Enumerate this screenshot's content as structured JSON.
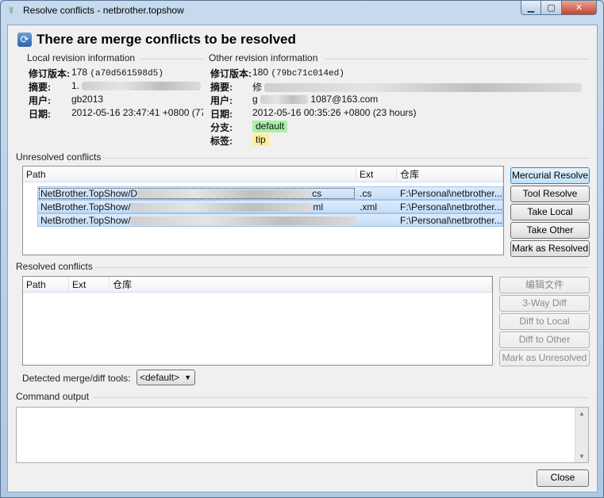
{
  "window": {
    "title": "Resolve conflicts - netbrother.topshow",
    "header": "There are merge conflicts to be resolved"
  },
  "local": {
    "section_label": "Local revision information",
    "revision_key": "修订版本:",
    "revision_value": "178",
    "revision_hash": "(a70d561598d5)",
    "summary_key": "摘要:",
    "summary_prefix": "1.",
    "user_key": "用户:",
    "user_value": "gb2013",
    "date_key": "日期:",
    "date_value": "2012-05-16 23:47:41 +0800 (77"
  },
  "other": {
    "section_label": "Other revision information",
    "revision_key": "修订版本:",
    "revision_value": "180",
    "revision_hash": "(79bc71c014ed)",
    "summary_key": "摘要:",
    "summary_prefix": "修",
    "user_key": "用户:",
    "user_prefix": "g",
    "user_suffix": "1087@163.com",
    "date_key": "日期:",
    "date_value": "2012-05-16 00:35:26 +0800 (23 hours)",
    "branch_key": "分支:",
    "branch_value": "default",
    "tags_key": "标签:",
    "tags_value": "tip"
  },
  "unresolved": {
    "label": "Unresolved conflicts",
    "columns": [
      "Path",
      "Ext",
      "仓库"
    ],
    "rows": [
      {
        "path_prefix": "NetBrother.TopShow/D",
        "path_suffix": "cs",
        "ext": ".cs",
        "repo": "F:\\Personal\\netbrother...."
      },
      {
        "path_prefix": "NetBrother.TopShow/",
        "path_suffix": "ml",
        "ext": ".xml",
        "repo": "F:\\Personal\\netbrother...."
      },
      {
        "path_prefix": "NetBrother.TopShow/",
        "path_suffix": "",
        "ext": "",
        "repo": "F:\\Personal\\netbrother...."
      }
    ],
    "buttons": {
      "mercurial_resolve": "Mercurial Resolve",
      "tool_resolve": "Tool Resolve",
      "take_local": "Take Local",
      "take_other": "Take Other",
      "mark_resolved": "Mark as Resolved"
    }
  },
  "resolved": {
    "label": "Resolved conflicts",
    "columns": [
      "Path",
      "Ext",
      "仓库"
    ],
    "buttons": {
      "edit_file": "编辑文件",
      "three_way_diff": "3-Way Diff",
      "diff_to_local": "Diff to Local",
      "diff_to_other": "Diff to Other",
      "mark_unresolved": "Mark as Unresolved"
    }
  },
  "tools": {
    "label": "Detected merge/diff tools:",
    "selected": "<default>"
  },
  "output": {
    "label": "Command output"
  },
  "footer": {
    "close": "Close"
  },
  "icons": {
    "app": "mercurial-icon",
    "header": "refresh-icon"
  }
}
